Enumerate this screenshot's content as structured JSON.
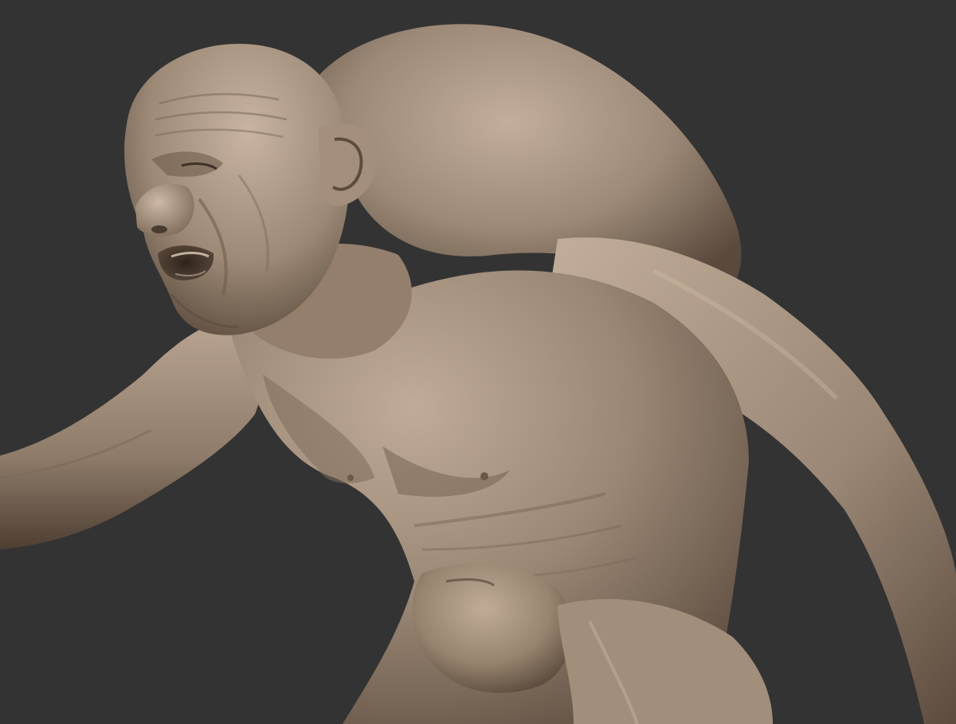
{
  "scene": {
    "background_color": "#333333",
    "material_base": "#9a8775",
    "material_highlight": "#c9b6a3",
    "material_shadow": "#4a3b30",
    "subject": "sculpt-render"
  }
}
